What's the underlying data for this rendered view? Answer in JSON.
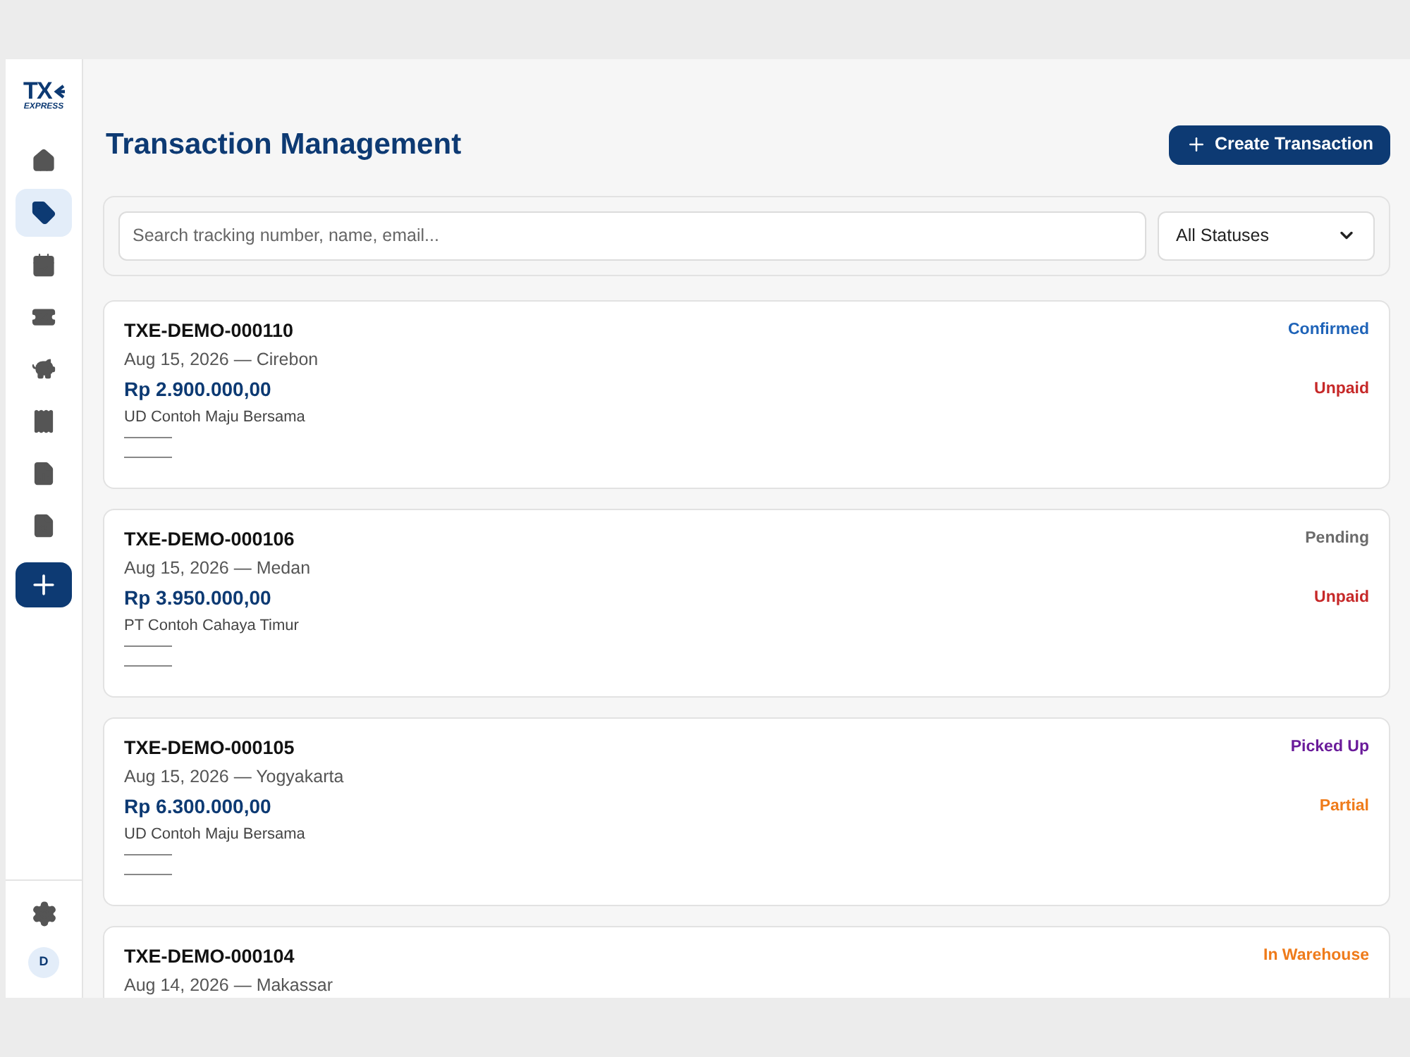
{
  "logo": {
    "mark": "TX",
    "sub": "EXPRESS"
  },
  "sidebar": {
    "items": [
      {
        "selected": false
      },
      {
        "selected": true
      },
      {
        "selected": false
      },
      {
        "selected": false
      },
      {
        "selected": false
      },
      {
        "selected": false
      },
      {
        "selected": false
      },
      {
        "selected": false
      }
    ],
    "avatar": "D"
  },
  "page": {
    "title": "Transaction Management",
    "create_button": "Create Transaction"
  },
  "filters": {
    "search": {
      "placeholder": "Search tracking number, name, email..."
    },
    "status_select": "All Statuses"
  },
  "transactions": [
    {
      "id": "TXE-DEMO-000110",
      "date_city": "Aug 15, 2026 — Cirebon",
      "amount": "Rp 2.900.000,00",
      "customer": "UD Contoh Maju Bersama",
      "status": {
        "text": "Confirmed",
        "color": "#1e63b8"
      },
      "payment": {
        "text": "Unpaid",
        "color": "#c62828"
      }
    },
    {
      "id": "TXE-DEMO-000106",
      "date_city": "Aug 15, 2026 — Medan",
      "amount": "Rp 3.950.000,00",
      "customer": "PT Contoh Cahaya Timur",
      "status": {
        "text": "Pending",
        "color": "#6b6b6b"
      },
      "payment": {
        "text": "Unpaid",
        "color": "#c62828"
      }
    },
    {
      "id": "TXE-DEMO-000105",
      "date_city": "Aug 15, 2026 — Yogyakarta",
      "amount": "Rp 6.300.000,00",
      "customer": "UD Contoh Maju Bersama",
      "status": {
        "text": "Picked Up",
        "color": "#6a1b9a"
      },
      "payment": {
        "text": "Partial",
        "color": "#ef7b1a"
      }
    },
    {
      "id": "TXE-DEMO-000104",
      "date_city": "Aug 14, 2026 — Makassar",
      "status": {
        "text": "In Warehouse",
        "color": "#ef7b1a"
      }
    }
  ]
}
